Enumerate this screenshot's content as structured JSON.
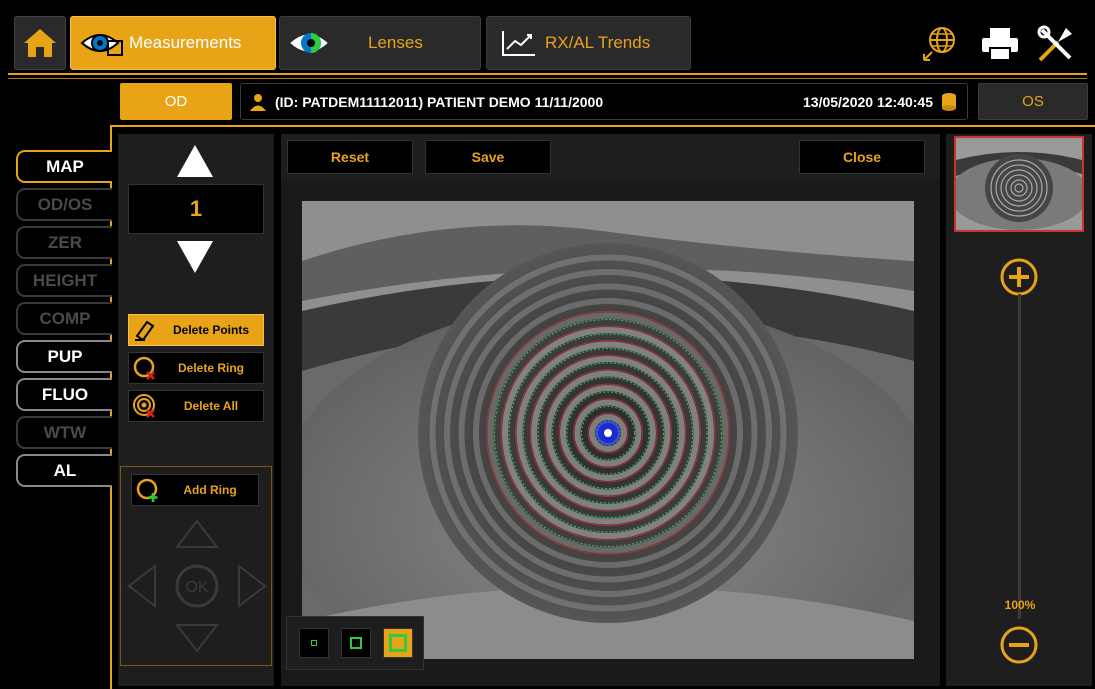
{
  "nav": {
    "tabs": [
      {
        "label": "Measurements",
        "icon": "eye-measure-icon"
      },
      {
        "label": "Lenses",
        "icon": "lens-eye-icon"
      },
      {
        "label": "RX/AL Trends",
        "icon": "trend-chart-icon"
      }
    ],
    "right_icons": [
      "globe-icon",
      "printer-icon",
      "tools-icon"
    ]
  },
  "patient_bar": {
    "od_label": "OD",
    "patient": "(ID: PATDEM11112011) PATIENT DEMO 11/11/2000",
    "datetime": "13/05/2020 12:40:45",
    "os_label": "OS"
  },
  "map_menu": [
    {
      "label": "MAP",
      "state": "active"
    },
    {
      "label": "OD/OS",
      "state": "disabled"
    },
    {
      "label": "ZER",
      "state": "disabled"
    },
    {
      "label": "HEIGHT",
      "state": "disabled"
    },
    {
      "label": "COMP",
      "state": "disabled"
    },
    {
      "label": "PUP",
      "state": "enabled"
    },
    {
      "label": "FLUO",
      "state": "enabled"
    },
    {
      "label": "WTW",
      "state": "disabled"
    },
    {
      "label": "AL",
      "state": "enabled"
    }
  ],
  "tools": {
    "counter": "1",
    "delete_points": "Delete Points",
    "delete_ring": "Delete Ring",
    "delete_all": "Delete All",
    "add_ring": "Add Ring",
    "ok": "OK"
  },
  "actions": {
    "reset": "Reset",
    "save": "Save",
    "close": "Close"
  },
  "zoom": {
    "level": "100%"
  },
  "colors": {
    "accent": "#e8a317",
    "panel": "#1e1e1e",
    "background": "#000000"
  }
}
